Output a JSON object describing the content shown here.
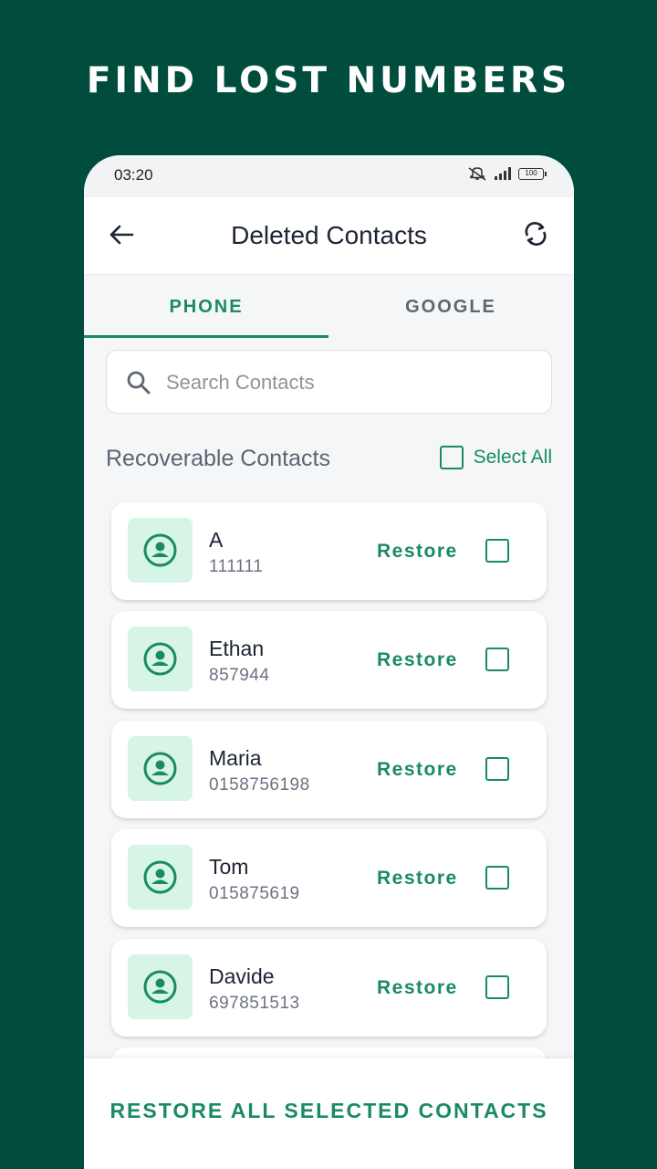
{
  "headline": "FIND LOST NUMBERS",
  "status_bar": {
    "time": "03:20",
    "battery": "100"
  },
  "app_bar": {
    "title": "Deleted Contacts"
  },
  "tabs": [
    {
      "label": "PHONE",
      "selected": true
    },
    {
      "label": "GOOGLE",
      "selected": false
    }
  ],
  "search": {
    "placeholder": "Search Contacts"
  },
  "section": {
    "title": "Recoverable Contacts",
    "select_all": "Select All"
  },
  "contacts": [
    {
      "name": "A",
      "number": "111111",
      "action": "Restore"
    },
    {
      "name": "Ethan",
      "number": "857944",
      "action": "Restore"
    },
    {
      "name": "Maria",
      "number": "0158756198",
      "action": "Restore"
    },
    {
      "name": "Tom",
      "number": "015875619",
      "action": "Restore"
    },
    {
      "name": "Davide",
      "number": "697851513",
      "action": "Restore"
    }
  ],
  "bottom_button": "RESTORE ALL SELECTED CONTACTS",
  "colors": {
    "background": "#004d3d",
    "accent": "#1a8a65",
    "avatar_bg": "#d6f5e6"
  }
}
